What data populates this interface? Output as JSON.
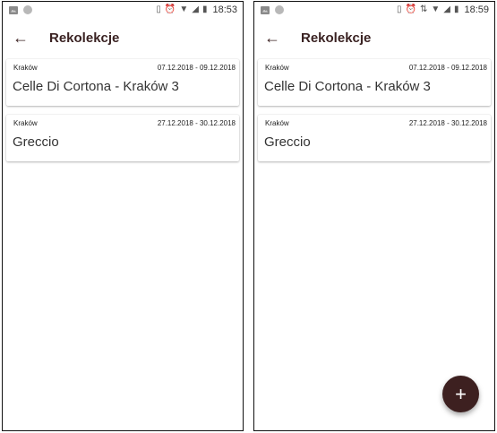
{
  "screens": [
    {
      "status_bar": {
        "time": "18:53"
      },
      "app_bar": {
        "title": "Rekolekcje"
      },
      "cards": [
        {
          "city": "Kraków",
          "dates": "07.12.2018 - 09.12.2018",
          "title": "Celle Di Cortona - Kraków 3"
        },
        {
          "city": "Kraków",
          "dates": "27.12.2018 - 30.12.2018",
          "title": "Greccio"
        }
      ]
    },
    {
      "status_bar": {
        "time": "18:59"
      },
      "app_bar": {
        "title": "Rekolekcje"
      },
      "cards": [
        {
          "city": "Kraków",
          "dates": "07.12.2018 - 09.12.2018",
          "title": "Celle Di Cortona - Kraków 3"
        },
        {
          "city": "Kraków",
          "dates": "27.12.2018 - 30.12.2018",
          "title": "Greccio"
        }
      ],
      "fab": {
        "label": "+"
      }
    }
  ],
  "colors": {
    "accent": "#3d2020",
    "title_text": "#3a2222"
  }
}
